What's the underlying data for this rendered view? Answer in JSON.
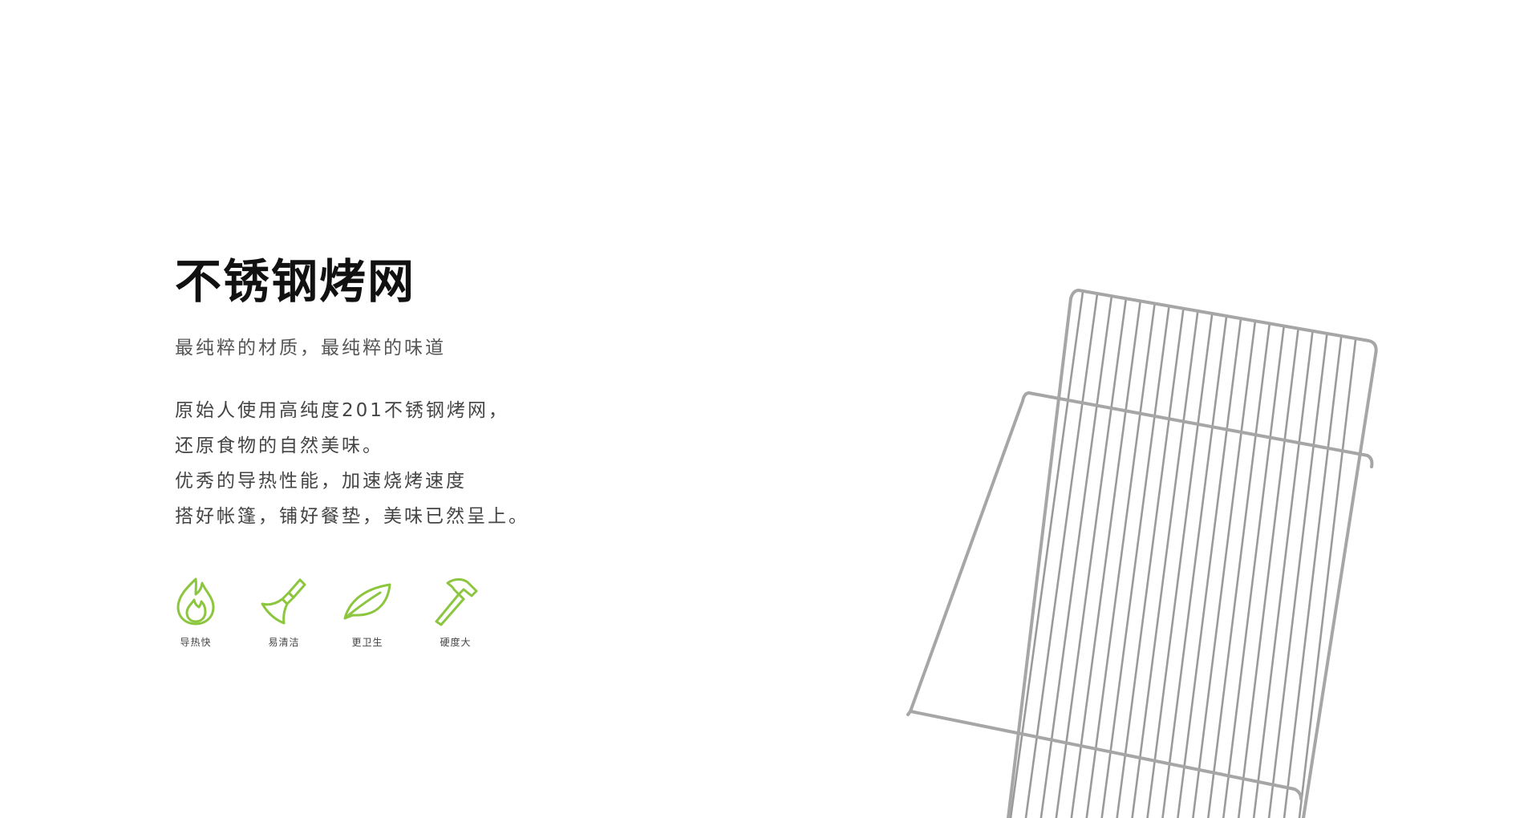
{
  "title": "不锈钢烤网",
  "subtitle": "最纯粹的材质，最纯粹的味道",
  "description": [
    "原始人使用高纯度201不锈钢烤网，",
    "还原食物的自然美味。",
    "优秀的导热性能，加速烧烤速度",
    "搭好帐篷，铺好餐垫，美味已然呈上。"
  ],
  "features": [
    {
      "icon": "flame-icon",
      "label": "导热快"
    },
    {
      "icon": "brush-icon",
      "label": "易清洁"
    },
    {
      "icon": "leaf-icon",
      "label": "更卫生"
    },
    {
      "icon": "hammer-icon",
      "label": "硬度大"
    }
  ],
  "colors": {
    "accent": "#8cc63f",
    "title": "#111111",
    "text": "#444444",
    "wire": "#b8b8b8"
  },
  "product_image": "stainless-steel-grill-grate"
}
